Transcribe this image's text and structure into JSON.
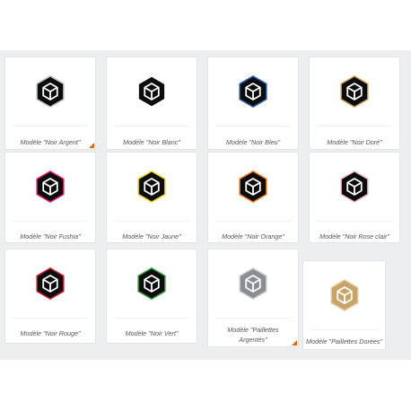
{
  "products": [
    {
      "label": "Modèle \"Noir Argent\"",
      "accent": "#b8bbbf",
      "body": "#0d0d0d",
      "selected": true
    },
    {
      "label": "Modèle \"Noir Blanc\"",
      "accent": "#ffffff",
      "body": "#0d0d0d",
      "selected": false
    },
    {
      "label": "Modèle \"Noir Bleu\"",
      "accent": "#2a5fb0",
      "body": "#0d0d0d",
      "selected": false
    },
    {
      "label": "Modèle \"Noir Doré\"",
      "accent": "#c9a15a",
      "body": "#0d0d0d",
      "selected": false
    },
    {
      "label": "Modèle \"Noir Fushia\"",
      "accent": "#e0237a",
      "body": "#0d0d0d",
      "selected": false
    },
    {
      "label": "Modèle \"Noir Jaune\"",
      "accent": "#f2d21b",
      "body": "#0d0d0d",
      "selected": false
    },
    {
      "label": "Modèle \"Noir Orange\"",
      "accent": "#f07a1a",
      "body": "#0d0d0d",
      "selected": false
    },
    {
      "label": "Modèle \"Noir Rose clair\"",
      "accent": "#f2b7c6",
      "body": "#0d0d0d",
      "selected": false
    },
    {
      "label": "Modèle \"Noir Rouge\"",
      "accent": "#d2202a",
      "body": "#0d0d0d",
      "selected": false
    },
    {
      "label": "Modèle \"Noir Vert\"",
      "accent": "#2f9a3a",
      "body": "#0d0d0d",
      "selected": false
    },
    {
      "label": "Modèle \"Paillettes Argentés\"",
      "accent": "#cfd2d6",
      "body": "#8a8d92",
      "selected": true
    },
    {
      "label": "Modèle \"Paillettes Dorées\"",
      "accent": "#e8d3a8",
      "body": "#c9a46a",
      "selected": false
    }
  ],
  "icons": {
    "badge": "hexagon-cube-icon",
    "selected_marker": "corner-triangle-icon"
  },
  "colors": {
    "selected_marker": "#e8641b",
    "panel_bg": "#eceeef"
  }
}
